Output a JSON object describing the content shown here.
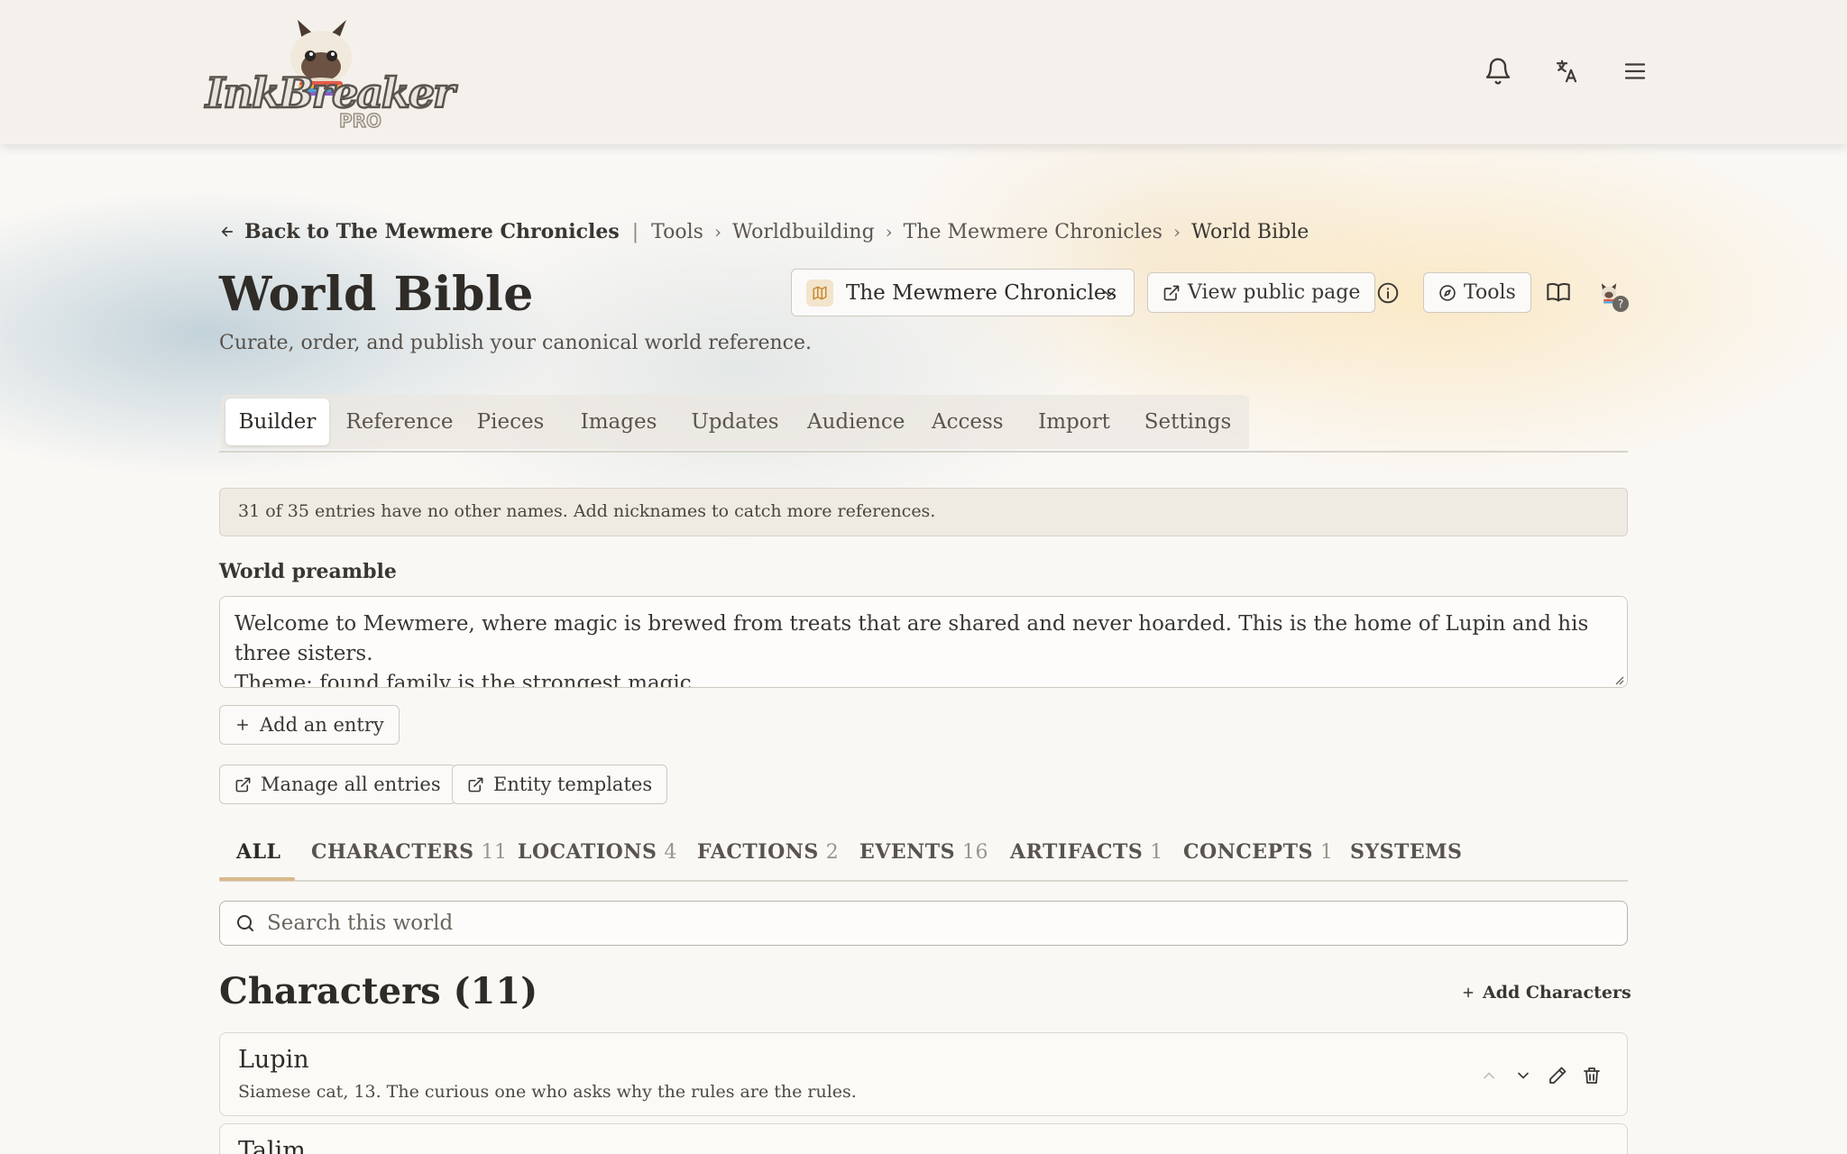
{
  "app": {
    "logo_text": "InkBreaker",
    "logo_badge": "PRO"
  },
  "topbar": {
    "icons": [
      "bell-icon",
      "translate-icon",
      "menu-icon"
    ]
  },
  "breadcrumb": {
    "back_label": "Back to The Mewmere Chronicles",
    "items": [
      "Tools",
      "Worldbuilding",
      "The Mewmere Chronicles"
    ],
    "current": "World Bible"
  },
  "page": {
    "title": "World Bible",
    "subtitle": "Curate, order, and publish your canonical world reference."
  },
  "header_controls": {
    "project_select_value": "The Mewmere Chronicles",
    "view_public_label": "View public page",
    "tools_label": "Tools",
    "help_badge": "?"
  },
  "tabs": [
    {
      "label": "Builder",
      "active": true
    },
    {
      "label": "Reference"
    },
    {
      "label": "Pieces"
    },
    {
      "label": "Images"
    },
    {
      "label": "Updates"
    },
    {
      "label": "Audience"
    },
    {
      "label": "Access"
    },
    {
      "label": "Import"
    },
    {
      "label": "Settings"
    }
  ],
  "notice": "31 of 35 entries have no other names. Add nicknames to catch more references.",
  "preamble": {
    "label": "World preamble",
    "value": "Welcome to Mewmere, where magic is brewed from treats that are shared and never hoarded. This is the home of Lupin and his three sisters.\nTheme: found family is the strongest magic."
  },
  "buttons": {
    "add_entry": "Add an entry",
    "manage_entries": "Manage all entries",
    "entity_templates": "Entity templates"
  },
  "categories": [
    {
      "label": "ALL",
      "count": ""
    },
    {
      "label": "CHARACTERS",
      "count": "11"
    },
    {
      "label": "LOCATIONS",
      "count": "4"
    },
    {
      "label": "FACTIONS",
      "count": "2"
    },
    {
      "label": "EVENTS",
      "count": "16"
    },
    {
      "label": "ARTIFACTS",
      "count": "1"
    },
    {
      "label": "CONCEPTS",
      "count": "1"
    },
    {
      "label": "SYSTEMS",
      "count": ""
    }
  ],
  "search": {
    "placeholder": "Search this world"
  },
  "characters_section": {
    "heading": "Characters (11)",
    "add_label": "Add Characters"
  },
  "entries": [
    {
      "name": "Lupin",
      "description": "Siamese cat, 13. The curious one who asks why the rules are the rules."
    },
    {
      "name": "Talim",
      "description": ""
    }
  ],
  "colors": {
    "accent_underline": "#d9b98a",
    "page_bg": "#faf8f5",
    "topbar_bg": "#f4f1ec"
  }
}
